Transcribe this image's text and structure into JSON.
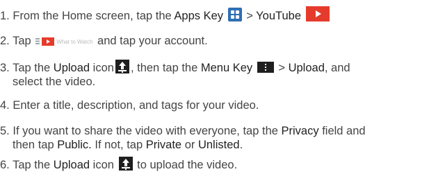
{
  "steps": [
    {
      "num": "1.",
      "t1": "From the Home screen, tap the",
      "apps_key": "Apps Key",
      "gt": ">",
      "youtube": "YouTube",
      "apps_icon": "apps-grid-icon",
      "youtube_icon": "youtube-icon"
    },
    {
      "num": "2.",
      "t1": "Tap",
      "wtw_label": "What to Watch",
      "t2": "and tap your account."
    },
    {
      "num": "3.",
      "t1": "Tap the",
      "upload": "Upload",
      "t2": "icon",
      "t3": ", then tap the",
      "menu_key": "Menu Key",
      "gt": ">",
      "upload2": "Upload",
      "t4": ", and",
      "line2": "select the video."
    },
    {
      "num": "4.",
      "t1": "Enter a title, description, and tags for your video."
    },
    {
      "num": "5.",
      "t1": "If you want to share the video with everyone, tap the",
      "privacy": "Privacy",
      "t2": "field and",
      "t3": "then tap",
      "public": "Public.",
      "t4": "If not, tap",
      "private": "Private",
      "or": "or",
      "unlisted": "Unlisted",
      "end": "."
    },
    {
      "num": "6.",
      "t1": "Tap the",
      "upload": "Upload",
      "t2": "icon",
      "t3": "to upload the video."
    }
  ],
  "colors": {
    "text": "#444444",
    "bold_text": "#222222",
    "apps_icon": "#2f6fb3",
    "youtube_red": "#e53b2c",
    "icon_dark": "#1f1f1f"
  }
}
